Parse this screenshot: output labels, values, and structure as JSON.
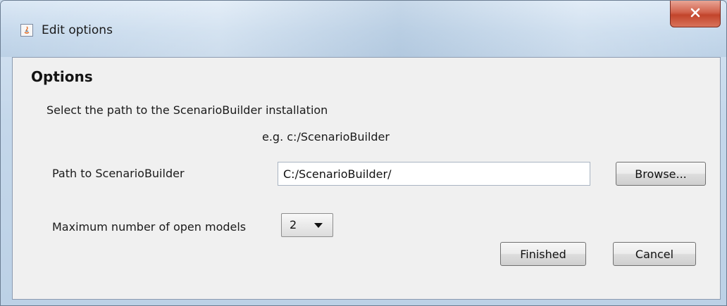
{
  "window": {
    "title": "Edit options"
  },
  "dialog": {
    "heading": "Options",
    "instruction": "Select the path to the ScenarioBuilder installation",
    "example": "e.g. c:/ScenarioBuilder",
    "path_label": "Path to ScenarioBuilder",
    "path_value": "C:/ScenarioBuilder/",
    "browse_label": "Browse...",
    "max_models_label": "Maximum number of open models",
    "max_models_value": "2",
    "finished_label": "Finished",
    "cancel_label": "Cancel"
  },
  "icons": {
    "title": "java-app-icon",
    "close": "close-icon",
    "dropdown": "chevron-down-icon"
  },
  "colors": {
    "title_bar": "#c6d9ec",
    "close_button": "#c2442b",
    "panel_background": "#f0f0f0"
  }
}
